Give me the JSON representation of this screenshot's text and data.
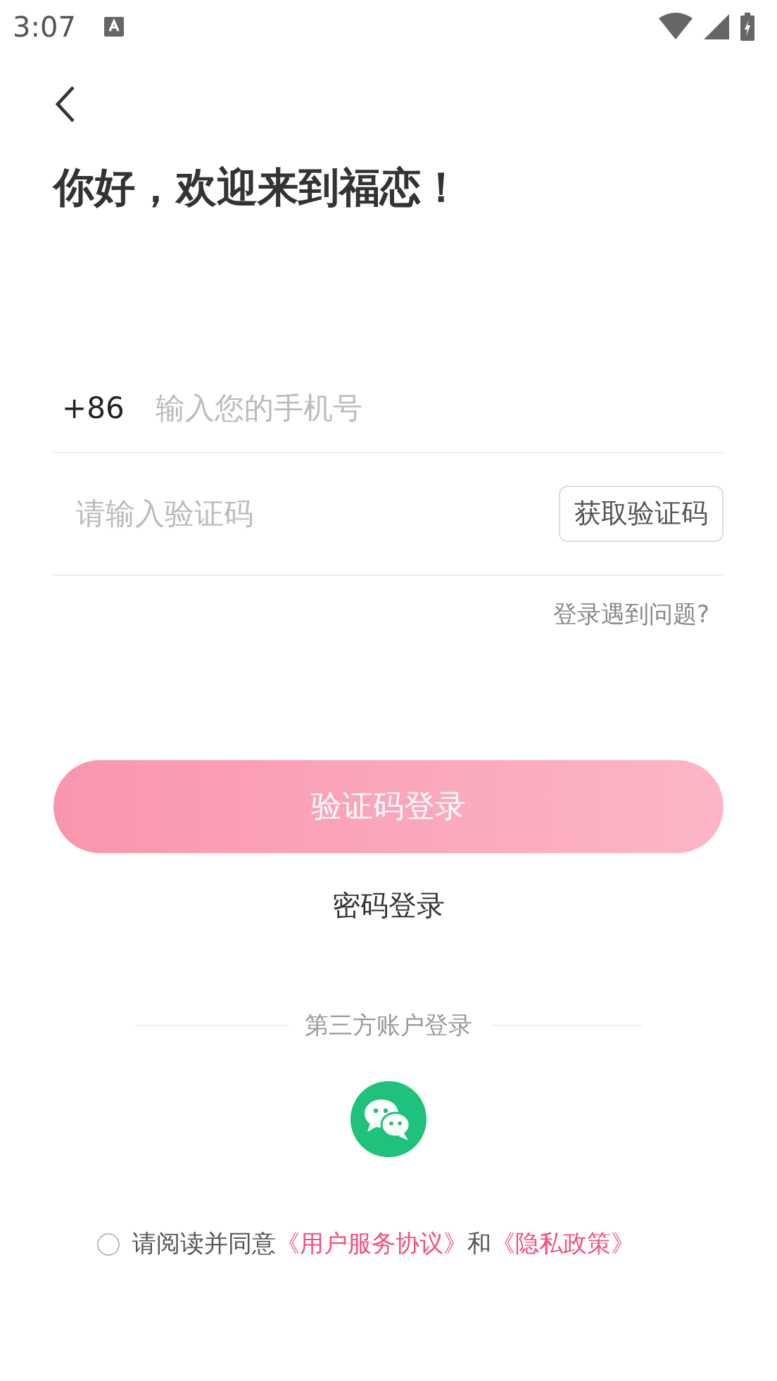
{
  "status_bar": {
    "time": "3:07"
  },
  "title": "你好，欢迎来到福恋！",
  "phone_field": {
    "country_code": "+86",
    "placeholder": "输入您的手机号"
  },
  "code_field": {
    "placeholder": "请输入验证码",
    "button": "获取验证码"
  },
  "help_link": "登录遇到问题?",
  "login_button": "验证码登录",
  "password_login": "密码登录",
  "third_party": {
    "label": "第三方账户登录"
  },
  "agreement": {
    "agreed": false,
    "prefix": "请阅读并同意",
    "link_1": "《用户服务协议》",
    "middle": "和",
    "link_2": "《隐私政策》"
  }
}
